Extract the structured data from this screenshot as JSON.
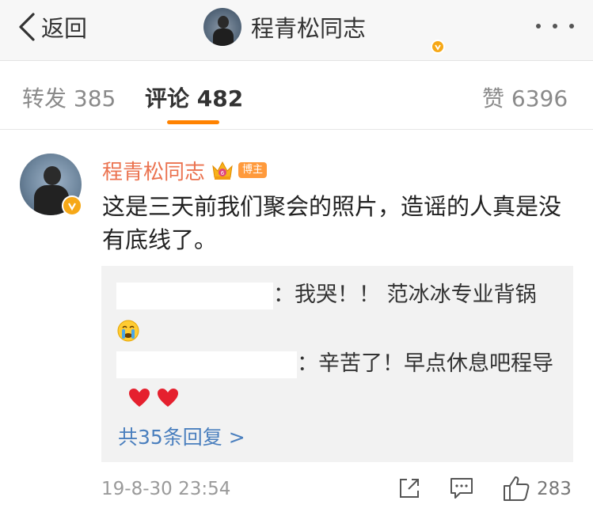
{
  "header": {
    "back_label": "返回",
    "title": "程青松同志"
  },
  "tabs": [
    {
      "label": "转发 385",
      "active": false
    },
    {
      "label": "评论 482",
      "active": true
    },
    {
      "label": "赞 6396",
      "active": false
    }
  ],
  "comment": {
    "author": "程青松同志",
    "author_badge": "博主",
    "text": "这是三天前我们聚会的照片，造谣的人真是没有底线了。",
    "replies": [
      {
        "text": "：我哭！！ 范冰冰专业背锅",
        "emoji": [
          "crying-face"
        ]
      },
      {
        "text": "：辛苦了！早点休息吧程导",
        "emoji": [
          "red-heart",
          "red-heart"
        ]
      }
    ],
    "more_replies_label": "共35条回复 >",
    "timestamp": "19-8-30 23:54",
    "like_count": "283"
  },
  "colors": {
    "accent": "#ff8200",
    "author_name": "#eb7350",
    "link": "#4a7fbe",
    "verified_badge": "#f6a817"
  }
}
